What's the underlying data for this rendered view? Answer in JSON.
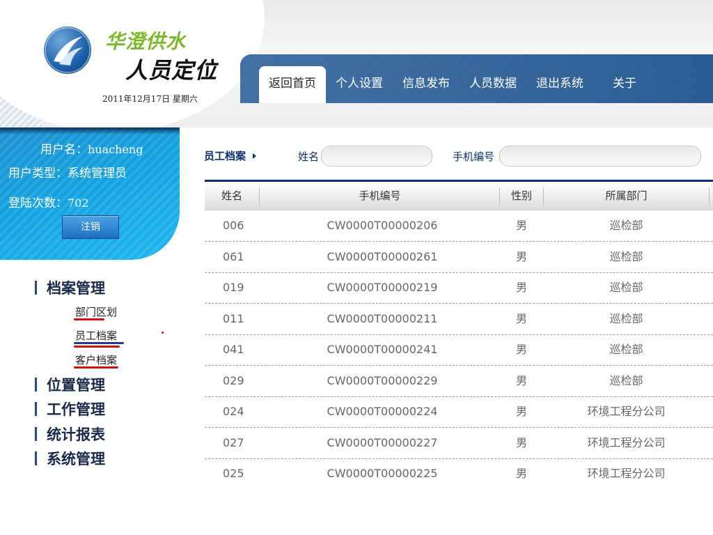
{
  "header": {
    "brand_line1": "华澄供水",
    "brand_line2": "人员定位",
    "date": "2011年12月17日 星期六",
    "nav_tabs": [
      {
        "label": "返回首页",
        "active": true
      },
      {
        "label": "个人设置",
        "active": false
      },
      {
        "label": "信息发布",
        "active": false
      },
      {
        "label": "人员数据",
        "active": false
      },
      {
        "label": "退出系统",
        "active": false
      },
      {
        "label": "关于",
        "active": false
      }
    ]
  },
  "user": {
    "name_label": "用户名：",
    "name": "huacheng",
    "type_label": "用户类型：",
    "type": "系统管理员",
    "logins_label": "登陆次数：",
    "logins": "702",
    "logout_label": "注销"
  },
  "menu": {
    "archive": "档案管理",
    "archive_items": [
      "部门区划",
      "员工档案",
      "客户档案"
    ],
    "location": "位置管理",
    "work": "工作管理",
    "reports": "统计报表",
    "system": "系统管理"
  },
  "filter": {
    "breadcrumb": "员工档案",
    "name_label": "姓名",
    "name_value": "",
    "phone_label": "手机编号",
    "phone_value": ""
  },
  "table": {
    "columns": [
      "姓名",
      "手机编号",
      "性别",
      "所属部门"
    ],
    "rows": [
      [
        "006",
        "CW0000T00000206",
        "男",
        "巡检部"
      ],
      [
        "061",
        "CW0000T00000261",
        "男",
        "巡检部"
      ],
      [
        "019",
        "CW0000T00000219",
        "男",
        "巡检部"
      ],
      [
        "011",
        "CW0000T00000211",
        "男",
        "巡检部"
      ],
      [
        "041",
        "CW0000T00000241",
        "男",
        "巡检部"
      ],
      [
        "029",
        "CW0000T00000229",
        "男",
        "巡检部"
      ],
      [
        "024",
        "CW0000T00000224",
        "男",
        "环境工程分公司"
      ],
      [
        "027",
        "CW0000T00000227",
        "男",
        "环境工程分公司"
      ],
      [
        "025",
        "CW0000T00000225",
        "男",
        "环境工程分公司"
      ]
    ]
  },
  "colors": {
    "brand_green": "#7cb82b",
    "nav_blue": "#2d5f97",
    "panel_blue": "#12a4e2",
    "menu_underline": "#cc1111",
    "active_underline": "#1b3f8f"
  },
  "icons": {
    "logo": "swoosh-logo-icon",
    "breadcrumb_arrow": "triangle-right-icon"
  }
}
